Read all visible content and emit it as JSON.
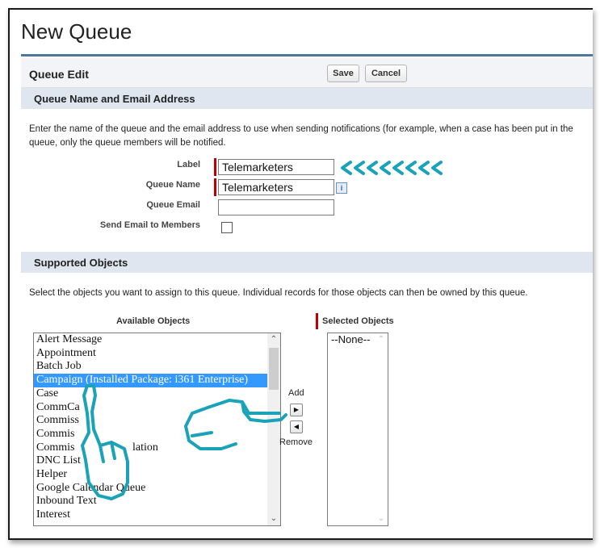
{
  "page": {
    "title": "New Queue"
  },
  "queue_edit": {
    "heading": "Queue Edit",
    "save": "Save",
    "cancel": "Cancel"
  },
  "section_name": {
    "heading": "Queue Name and Email Address",
    "help_line1": "Enter the name of the queue and the email address to use when sending notifications (for example, when a case has been put in the",
    "help_line2": "queue, only the queue members will be notified.",
    "fields": {
      "label": {
        "label": "Label",
        "value": "Telemarketers"
      },
      "queue_name": {
        "label": "Queue Name",
        "value": "Telemarketers",
        "info": "i"
      },
      "queue_email": {
        "label": "Queue Email",
        "value": ""
      },
      "send_email": {
        "label": "Send Email to Members",
        "checked": false
      }
    }
  },
  "section_objects": {
    "heading": "Supported Objects",
    "help": "Select the objects you want to assign to this queue. Individual records for those objects can then be owned by this queue.",
    "available_label": "Available Objects",
    "selected_label": "Selected Objects",
    "available": [
      "Alert Message",
      "Appointment",
      "Batch Job",
      "Campaign (Installed Package: i361 Enterprise)",
      "Case",
      "CommCa",
      "Commiss",
      "Commis",
      "Commis",
      "DNC List",
      "Helper",
      "Google Calendar Queue",
      "Inbound Text",
      "Interest"
    ],
    "available_extra": {
      "row8_suffix": "lation"
    },
    "selected_index": 3,
    "selected": [
      "--None--"
    ],
    "add_label": "Add",
    "remove_label": "Remove"
  },
  "annotations": {
    "accent_color": "#1aa3b8"
  }
}
